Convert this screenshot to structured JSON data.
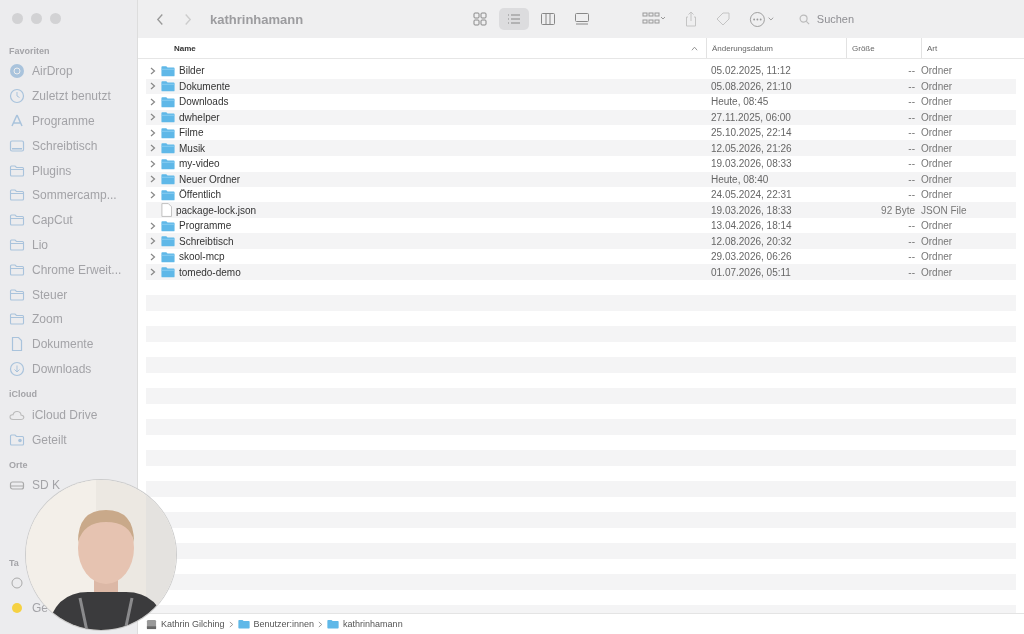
{
  "window": {
    "title": "kathrinhamann"
  },
  "sidebar": {
    "sections": [
      {
        "heading": "Favoriten",
        "items": [
          {
            "label": "AirDrop",
            "kind": "airdrop"
          },
          {
            "label": "Zuletzt benutzt",
            "kind": "recent"
          },
          {
            "label": "Programme",
            "kind": "apps"
          },
          {
            "label": "Schreibtisch",
            "kind": "desktop"
          },
          {
            "label": "Plugins",
            "kind": "folder"
          },
          {
            "label": "Sommercamp...",
            "kind": "folder"
          },
          {
            "label": "CapCut",
            "kind": "folder"
          },
          {
            "label": "Lio",
            "kind": "folder"
          },
          {
            "label": "Chrome Erweit...",
            "kind": "folder"
          },
          {
            "label": "Steuer",
            "kind": "folder"
          },
          {
            "label": "Zoom",
            "kind": "folder"
          },
          {
            "label": "Dokumente",
            "kind": "document"
          },
          {
            "label": "Downloads",
            "kind": "download"
          }
        ]
      },
      {
        "heading": "iCloud",
        "items": [
          {
            "label": "iCloud Drive",
            "kind": "cloud"
          },
          {
            "label": "Geteilt",
            "kind": "shared"
          }
        ]
      },
      {
        "heading": "Orte",
        "items": [
          {
            "label": "SD K",
            "kind": "drive"
          }
        ]
      },
      {
        "heading": "Ta",
        "items": [
          {
            "kind": "tag-outline"
          },
          {
            "label": "Ge",
            "kind": "tag",
            "color": "#f5d142"
          }
        ]
      }
    ]
  },
  "toolbar": {
    "views": [
      {
        "kind": "icons",
        "selected": false
      },
      {
        "kind": "list",
        "selected": true
      },
      {
        "kind": "columns",
        "selected": false
      },
      {
        "kind": "gallery",
        "selected": false
      }
    ],
    "search": {
      "placeholder": "Suchen"
    }
  },
  "table": {
    "columns": [
      "Name",
      "Änderungsdatum",
      "Größe",
      "Art"
    ],
    "rows": [
      {
        "name": "Bilder",
        "kind": "folder",
        "date": "05.02.2025, 11:12",
        "size": "--",
        "type": "Ordner"
      },
      {
        "name": "Dokumente",
        "kind": "folder",
        "date": "05.08.2026, 21:10",
        "size": "--",
        "type": "Ordner"
      },
      {
        "name": "Downloads",
        "kind": "folder",
        "date": "Heute, 08:45",
        "size": "--",
        "type": "Ordner"
      },
      {
        "name": "dwhelper",
        "kind": "folder",
        "date": "27.11.2025, 06:00",
        "size": "--",
        "type": "Ordner"
      },
      {
        "name": "Filme",
        "kind": "folder",
        "date": "25.10.2025, 22:14",
        "size": "--",
        "type": "Ordner"
      },
      {
        "name": "Musik",
        "kind": "folder",
        "date": "12.05.2026, 21:26",
        "size": "--",
        "type": "Ordner"
      },
      {
        "name": "my-video",
        "kind": "folder",
        "date": "19.03.2026, 08:33",
        "size": "--",
        "type": "Ordner"
      },
      {
        "name": "Neuer Ordner",
        "kind": "folder",
        "date": "Heute, 08:40",
        "size": "--",
        "type": "Ordner"
      },
      {
        "name": "Öffentlich",
        "kind": "folder",
        "date": "24.05.2024, 22:31",
        "size": "--",
        "type": "Ordner"
      },
      {
        "name": "package-lock.json",
        "kind": "file",
        "date": "19.03.2026, 18:33",
        "size": "92 Byte",
        "type": "JSON File"
      },
      {
        "name": "Programme",
        "kind": "folder",
        "date": "13.04.2026, 18:14",
        "size": "--",
        "type": "Ordner"
      },
      {
        "name": "Schreibtisch",
        "kind": "folder",
        "date": "12.08.2026, 20:32",
        "size": "--",
        "type": "Ordner"
      },
      {
        "name": "skool-mcp",
        "kind": "folder",
        "date": "29.03.2026, 06:26",
        "size": "--",
        "type": "Ordner"
      },
      {
        "name": "tomedo-demo",
        "kind": "folder",
        "date": "01.07.2026, 05:11",
        "size": "--",
        "type": "Ordner"
      }
    ]
  },
  "path_bar": [
    {
      "label": "Kathrin Gilching",
      "kind": "drive"
    },
    {
      "label": "Benutzer:innen",
      "kind": "folder"
    },
    {
      "label": "kathrinhamann",
      "kind": "folder"
    }
  ]
}
